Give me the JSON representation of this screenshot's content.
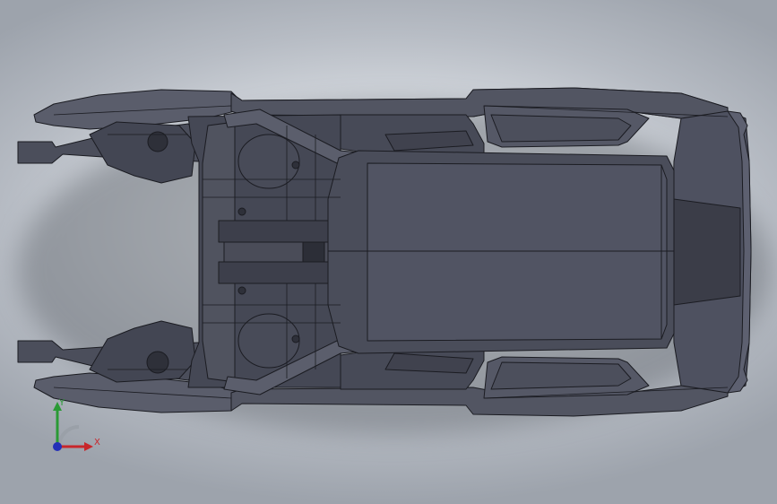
{
  "viewport": {
    "background_top": "#f2f4f7",
    "background_edge": "#9da3ac",
    "model_fill": "#4b4e5b",
    "model_dark": "#373945",
    "model_light": "#5a5d6b",
    "edge_color": "#1b1c22"
  },
  "model": {
    "name": "car-body-in-white",
    "view": "bottom"
  },
  "triad": {
    "x_label": "X",
    "y_label": "Y",
    "x_color": "#c8262b",
    "y_color": "#2a9a35",
    "z_color": "#2430b8"
  }
}
